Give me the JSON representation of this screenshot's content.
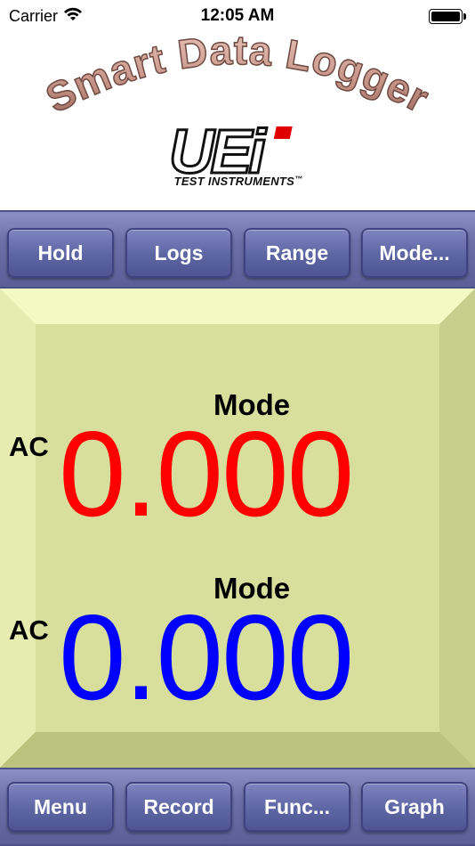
{
  "status_bar": {
    "carrier": "Carrier",
    "time": "12:05 AM",
    "wifi_icon": "wifi-icon",
    "battery_icon": "battery-full-icon"
  },
  "header": {
    "app_title": "Smart Data Logger",
    "logo_text": "UEi",
    "logo_subtitle": "TEST INSTRUMENTS",
    "logo_trademark": "™"
  },
  "top_toolbar": {
    "buttons": [
      "Hold",
      "Logs",
      "Range",
      "Mode..."
    ]
  },
  "display": {
    "primary": {
      "mode": "Mode",
      "coupling": "AC",
      "value": "0.000"
    },
    "secondary": {
      "mode": "Mode",
      "coupling": "AC",
      "value": "0.000"
    }
  },
  "bottom_toolbar": {
    "buttons": [
      "Menu",
      "Record",
      "Func...",
      "Graph"
    ]
  },
  "colors": {
    "toolbar": "#6b70a8",
    "display_bg": "#d8df9c",
    "primary_value": "#ff0000",
    "secondary_value": "#0000ff",
    "title_fill": "#c9968a",
    "logo_accent": "#e00000"
  }
}
